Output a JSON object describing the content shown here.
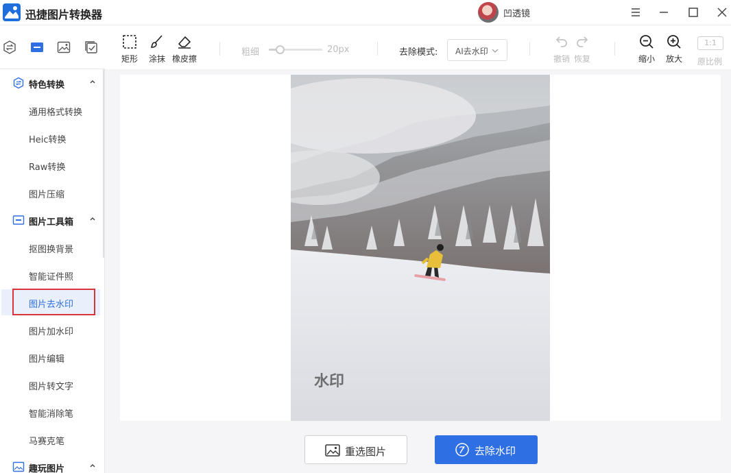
{
  "app": {
    "title": "迅捷图片转换器"
  },
  "user": {
    "name": "凹透镜"
  },
  "window_controls": [
    "menu-icon",
    "minimize-icon",
    "maximize-icon",
    "close-icon"
  ],
  "sidebar": {
    "top_icons": [
      "convert-icon",
      "toolbox-icon",
      "image-icon",
      "check-icon"
    ],
    "sections": [
      {
        "label": "特色转换",
        "icon": "convert-icon",
        "items": [
          "通用格式转换",
          "Heic转换",
          "Raw转换",
          "图片压缩"
        ]
      },
      {
        "label": "图片工具箱",
        "icon": "toolbox-icon",
        "items": [
          "抠图换背景",
          "智能证件照",
          "图片去水印",
          "图片加水印",
          "图片编辑",
          "图片转文字",
          "智能消除笔",
          "马赛克笔"
        ]
      },
      {
        "label": "趣玩图片",
        "icon": "image-icon",
        "items": []
      }
    ],
    "active_item": "图片去水印"
  },
  "toolbar": {
    "tools": [
      {
        "label": "矩形",
        "icon": "rectangle-select-icon"
      },
      {
        "label": "涂抹",
        "icon": "brush-icon"
      },
      {
        "label": "橡皮擦",
        "icon": "eraser-icon"
      }
    ],
    "size_label": "粗细",
    "size_value": "20px",
    "size_level": 0.2,
    "mode_label": "去除模式:",
    "mode_value": "AI去水印",
    "undo_label": "撤销",
    "redo_label": "恢复",
    "zoom_out_label": "缩小",
    "zoom_in_label": "放大",
    "ratio_box": "1:1",
    "original_label": "原比例"
  },
  "canvas": {
    "watermark_text": "水印"
  },
  "actions": {
    "reselect_label": "重选图片",
    "remove_label": "去除水印"
  },
  "colors": {
    "accent": "#2f6fe4",
    "active_border": "#d9333a",
    "active_bg": "#eaf0fb"
  }
}
